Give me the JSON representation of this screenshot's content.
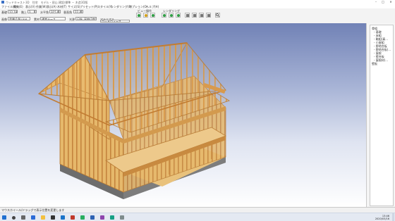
{
  "window": {
    "title": "ウッドキャスト3D　住宅　モデル・邸山 建設/標準 － 木造3D版"
  },
  "menubar": [
    "ファイル(F)",
    "編集(E)",
    "表示(V)",
    "作業(W)",
    "表示(A)",
    "木材(T)",
    "サイズ(S)",
    "プリセット(P)",
    "スタイル(Y)",
    "レンダリング(R)",
    "オプション(O)",
    "ヘルプ(H)"
  ],
  "toolbar": {
    "row1": {
      "label_a": "基礎",
      "val_a": "22.18",
      "label_b": "階上",
      "val_b": "2",
      "label_c": "水平角",
      "val_c": "315.0",
      "label_d": "垂直角",
      "val_d": "22.4",
      "group_view": "ビュー操作",
      "group_render": "レンダリング"
    },
    "row2": {
      "label_a": "画像",
      "val_a": "背景(1色).jpg",
      "label_b": "素材",
      "val_b": "通常テース",
      "label_c": "光源",
      "val_c": "日陰_平地(2群)",
      "label_d": "マテリアル",
      "val_d": "ウッドウィース"
    }
  },
  "sidebar": {
    "root": "骨組",
    "items": [
      "- 基礎",
      "- 床組",
      "- 軸組(真…",
      "- 小屋組",
      "- 野地合板",
      "- 野地合板(…",
      "- 屋根",
      "- 壁合板",
      "- 屋根材(…",
      "壁板"
    ]
  },
  "status": "マウスホイール/ドラッグで表示位置を変更します",
  "taskbar": {
    "time": "13:46",
    "date": "2020/03/16"
  }
}
